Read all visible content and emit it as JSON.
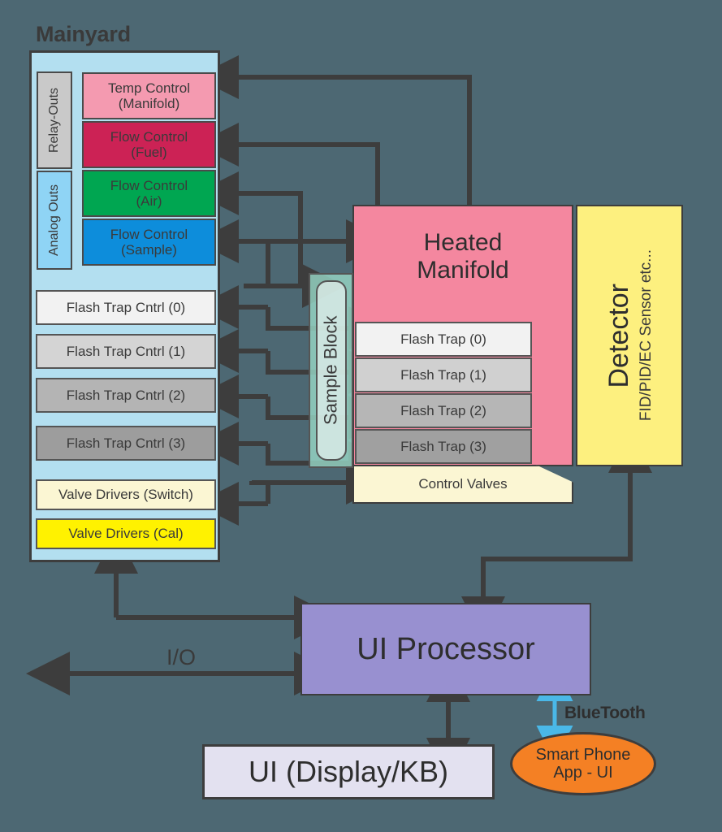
{
  "diagram": {
    "title": "Mainyard",
    "background_color": "#4d6873",
    "arrow_color": "#3d3d3d"
  },
  "mainyard": {
    "label": "Mainyard",
    "panel_color": "#b3dff0",
    "sidebar": [
      {
        "label": "Relay-Outs",
        "color": "#c9c9c9"
      },
      {
        "label": "Analog Outs",
        "color": "#8fd4f5"
      }
    ],
    "controls": [
      {
        "label": "Temp Control\n(Manifold)",
        "line1": "Temp Control",
        "line2": "(Manifold)",
        "color": "#f49ab0"
      },
      {
        "label": "Flow Control\n(Fuel)",
        "line1": "Flow Control",
        "line2": "(Fuel)",
        "color": "#cc2255"
      },
      {
        "label": "Flow Control\n(Air)",
        "line1": "Flow Control",
        "line2": "(Air)",
        "color": "#00a651"
      },
      {
        "label": "Flow Control\n(Sample)",
        "line1": "Flow Control",
        "line2": "(Sample)",
        "color": "#0d8ddb"
      }
    ],
    "flash_trap_controls": [
      {
        "label": "Flash Trap Cntrl (0)",
        "color": "#f2f2f2"
      },
      {
        "label": "Flash Trap Cntrl (1)",
        "color": "#d4d4d4"
      },
      {
        "label": "Flash Trap Cntrl (2)",
        "color": "#b4b4b4"
      },
      {
        "label": "Flash Trap Cntrl (3)",
        "color": "#9d9d9d"
      }
    ],
    "valve_drivers": [
      {
        "label": "Valve Drivers (Switch)",
        "color": "#fbf6d3"
      },
      {
        "label": "Valve Drivers (Cal)",
        "color": "#fff200"
      }
    ]
  },
  "manifold": {
    "title_line1": "Heated",
    "title_line2": "Manifold",
    "color": "#f4879f",
    "flash_traps": [
      {
        "label": "Flash Trap (0)",
        "color": "#f2f2f2"
      },
      {
        "label": "Flash Trap (1)",
        "color": "#d0d0d0"
      },
      {
        "label": "Flash Trap (2)",
        "color": "#b6b6b6"
      },
      {
        "label": "Flash Trap (3)",
        "color": "#a0a0a0"
      }
    ],
    "control_valves": {
      "label": "Control Valves",
      "color": "#fbf6d3"
    }
  },
  "sample_block": {
    "label": "Sample Block",
    "color": "#96d6c4"
  },
  "detector": {
    "title": "Detector",
    "subtitle": "FID/PID/EC Sensor etc...",
    "color": "#fdf07f"
  },
  "bottom": {
    "ui_processor": {
      "label": "UI Processor",
      "color": "#9890d0"
    },
    "ui_display": {
      "label": "UI (Display/KB)",
      "color": "#e3e1f0"
    },
    "smart_phone": {
      "line1": "Smart Phone",
      "line2": "App - UI",
      "color": "#f48024"
    },
    "io_label": "I/O",
    "bluetooth_label": "BlueTooth",
    "bluetooth_color": "#4ab8e8"
  }
}
